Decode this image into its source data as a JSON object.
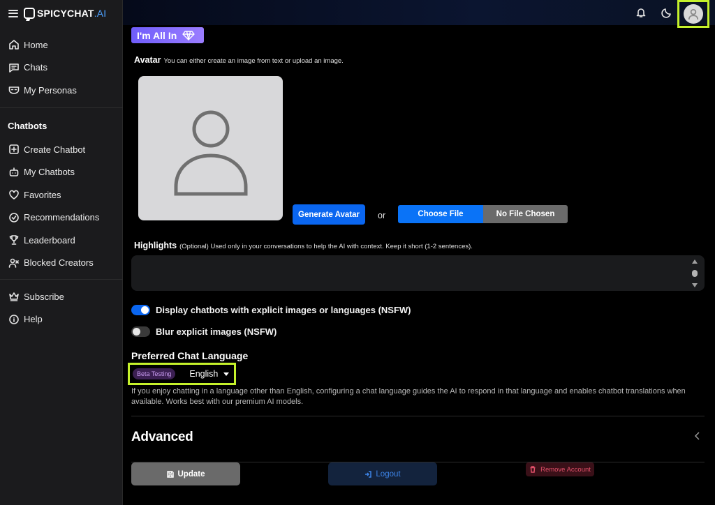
{
  "brand": {
    "name_main": "SPICYCHAT",
    "name_suffix": ".AI"
  },
  "sidebar": {
    "items_top": [
      {
        "label": "Home",
        "icon": "home-icon"
      },
      {
        "label": "Chats",
        "icon": "chat-icon"
      },
      {
        "label": "My Personas",
        "icon": "mask-icon"
      }
    ],
    "section_heading": "Chatbots",
    "items_chatbots": [
      {
        "label": "Create Chatbot",
        "icon": "plus-square-icon"
      },
      {
        "label": "My Chatbots",
        "icon": "bot-icon"
      },
      {
        "label": "Favorites",
        "icon": "heart-icon"
      },
      {
        "label": "Recommendations",
        "icon": "check-circle-icon"
      },
      {
        "label": "Leaderboard",
        "icon": "trophy-icon"
      },
      {
        "label": "Blocked Creators",
        "icon": "user-x-icon"
      }
    ],
    "items_bottom": [
      {
        "label": "Subscribe",
        "icon": "crown-icon"
      },
      {
        "label": "Help",
        "icon": "info-icon"
      }
    ]
  },
  "topbar": {
    "icons": [
      "bell-icon",
      "moon-icon",
      "user-avatar-icon"
    ]
  },
  "main": {
    "plan_badge": "I'm All In",
    "avatar": {
      "label": "Avatar",
      "hint": "You can either create an image from text or upload an image.",
      "generate_button": "Generate Avatar",
      "or_text": "or",
      "choose_file": "Choose File",
      "no_file": "No File Chosen"
    },
    "highlights": {
      "label": "Highlights",
      "hint": "(Optional) Used only in your conversations to help the AI with context. Keep it short (1-2 sentences).",
      "value": ""
    },
    "toggles": [
      {
        "label": "Display chatbots with explicit images or languages (NSFW)",
        "on": true
      },
      {
        "label": "Blur explicit images (NSFW)",
        "on": false
      }
    ],
    "language": {
      "title": "Preferred Chat Language",
      "badge": "Beta Testing",
      "selected": "English",
      "help": "If you enjoy chatting in a language other than English, configuring a chat language guides the AI to respond in that language and enables chatbot translations when available. Works best with our premium AI models."
    },
    "advanced_title": "Advanced",
    "actions": {
      "update": "Update",
      "logout": "Logout",
      "remove": "Remove Account"
    }
  },
  "colors": {
    "accent_blue": "#0a66f0",
    "highlight_frame": "#c5f12b",
    "danger": "#e2506a"
  }
}
